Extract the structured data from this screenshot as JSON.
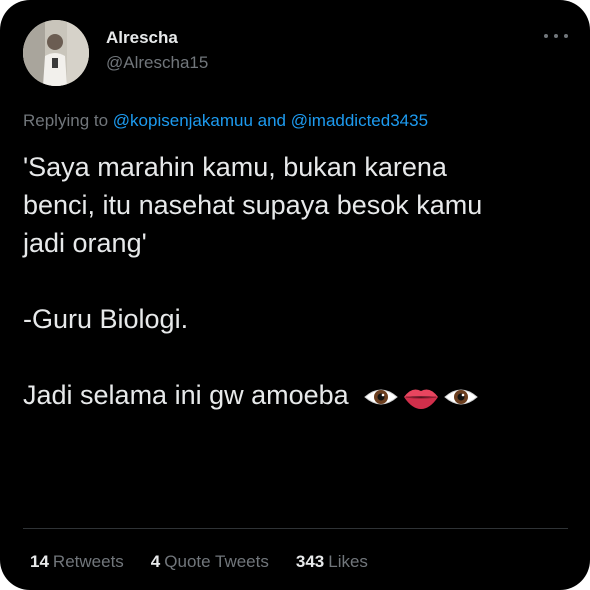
{
  "tweet": {
    "author": {
      "display_name": "Alrescha",
      "handle": "@Alrescha15"
    },
    "replying": {
      "prefix": "Replying to",
      "user1": "@kopisenjakamuu",
      "conjunction": "and",
      "user2": "@imaddicted3435"
    },
    "lines": [
      "'Saya marahin kamu, bukan karena",
      "benci, itu nasehat supaya besok kamu",
      "jadi orang'",
      "-Guru Biologi.",
      "Jadi selama ini gw amoeba"
    ],
    "emojis": [
      "eye-icon",
      "lips-icon",
      "eye-icon"
    ],
    "stats": {
      "retweets_count": "14",
      "retweets_label": "Retweets",
      "quotes_count": "4",
      "quotes_label": "Quote Tweets",
      "likes_count": "343",
      "likes_label": "Likes"
    }
  },
  "colors": {
    "background": "#000000",
    "text": "#e7e9ea",
    "muted": "#71767b",
    "link": "#1d9bf0",
    "divider": "#2f3336"
  }
}
